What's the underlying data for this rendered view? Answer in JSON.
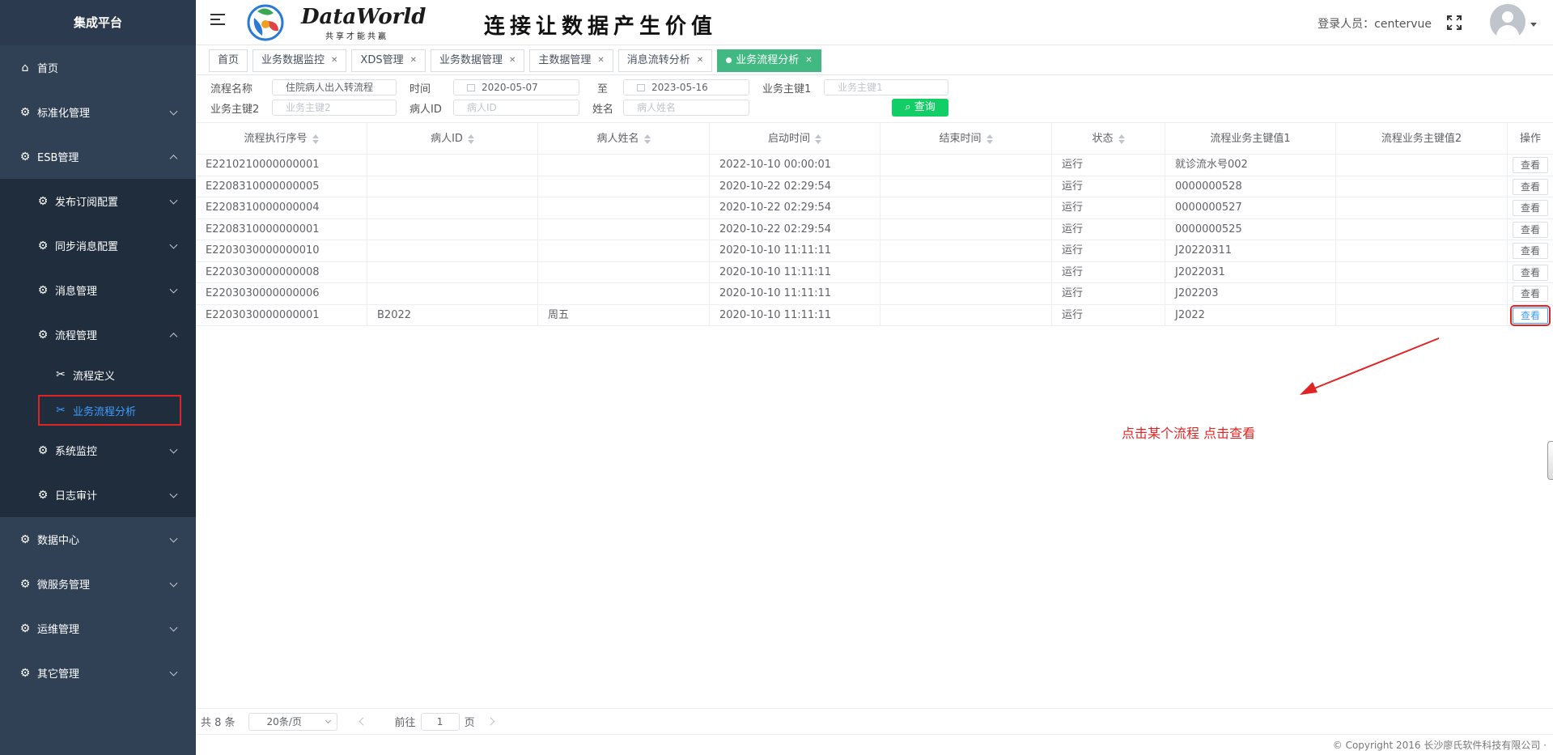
{
  "sidebar": {
    "title": "集成平台",
    "home": "首页",
    "standard": "标准化管理",
    "esb": "ESB管理",
    "esb_children": {
      "pubsub": "发布订阅配置",
      "sync": "同步消息配置",
      "message": "消息管理",
      "flow": "流程管理",
      "flow_children": {
        "definition": "流程定义",
        "analysis": "业务流程分析"
      },
      "monitor": "系统监控",
      "audit": "日志审计"
    },
    "datacenter": "数据中心",
    "microservice": "微服务管理",
    "ops": "运维管理",
    "other": "其它管理"
  },
  "header": {
    "brand": "DataWorld",
    "brand_sub": "共享才能共赢",
    "slogan": "连接让数据产生价值",
    "login": "登录人员：centervue"
  },
  "tabs": [
    {
      "label": "首页",
      "closable": false
    },
    {
      "label": "业务数据监控",
      "closable": true
    },
    {
      "label": "XDS管理",
      "closable": true
    },
    {
      "label": "业务数据管理",
      "closable": true
    },
    {
      "label": "主数据管理",
      "closable": true
    },
    {
      "label": "消息流转分析",
      "closable": true
    },
    {
      "label": "业务流程分析",
      "closable": true,
      "active": true
    }
  ],
  "filters": {
    "flow_name_label": "流程名称",
    "flow_name_value": "住院病人出入转流程",
    "time_label": "时间",
    "date_from": "2020-05-07",
    "to_label": "至",
    "date_to": "2023-05-16",
    "key1_label": "业务主键1",
    "key1_placeholder": "业务主键1",
    "key2_label": "业务主键2",
    "key2_placeholder": "业务主键2",
    "patient_id_label": "病人ID",
    "patient_id_placeholder": "病人ID",
    "name_label": "姓名",
    "name_placeholder": "病人姓名",
    "search_label": "查询"
  },
  "table": {
    "columns": [
      "流程执行序号",
      "病人ID",
      "病人姓名",
      "启动时间",
      "结束时间",
      "状态",
      "流程业务主键值1",
      "流程业务主键值2",
      "操作"
    ],
    "view_label": "查看",
    "rows": [
      [
        "E2210210000000001",
        "",
        "",
        "2022-10-10 00:00:01",
        "",
        "运行",
        "就诊流水号002",
        ""
      ],
      [
        "E2208310000000005",
        "",
        "",
        "2020-10-22 02:29:54",
        "",
        "运行",
        "0000000528",
        ""
      ],
      [
        "E2208310000000004",
        "",
        "",
        "2020-10-22 02:29:54",
        "",
        "运行",
        "0000000527",
        ""
      ],
      [
        "E2208310000000001",
        "",
        "",
        "2020-10-22 02:29:54",
        "",
        "运行",
        "0000000525",
        ""
      ],
      [
        "E2203030000000010",
        "",
        "",
        "2020-10-10 11:11:11",
        "",
        "运行",
        "J20220311",
        ""
      ],
      [
        "E2203030000000008",
        "",
        "",
        "2020-10-10 11:11:11",
        "",
        "运行",
        "J2022031",
        ""
      ],
      [
        "E2203030000000006",
        "",
        "",
        "2020-10-10 11:11:11",
        "",
        "运行",
        "J202203",
        ""
      ],
      [
        "E2203030000000001",
        "B2022",
        "周五",
        "2020-10-10 11:11:11",
        "",
        "运行",
        "J2022",
        ""
      ]
    ]
  },
  "annotation": {
    "note": "点击某个流程 点击查看"
  },
  "pager": {
    "total": "共 8 条",
    "page_size": "20条/页",
    "goto_label": "前往",
    "page": "1",
    "page_suffix": "页"
  },
  "footer": {
    "copyright": "© Copyright 2016 长沙廖氏软件科技有限公司 ·"
  },
  "colors": {
    "sidebar_bg": "#304156",
    "active_tab": "#42b983",
    "search_button": "#13ce66",
    "highlight": "#e02424",
    "link_blue": "#409eff"
  }
}
